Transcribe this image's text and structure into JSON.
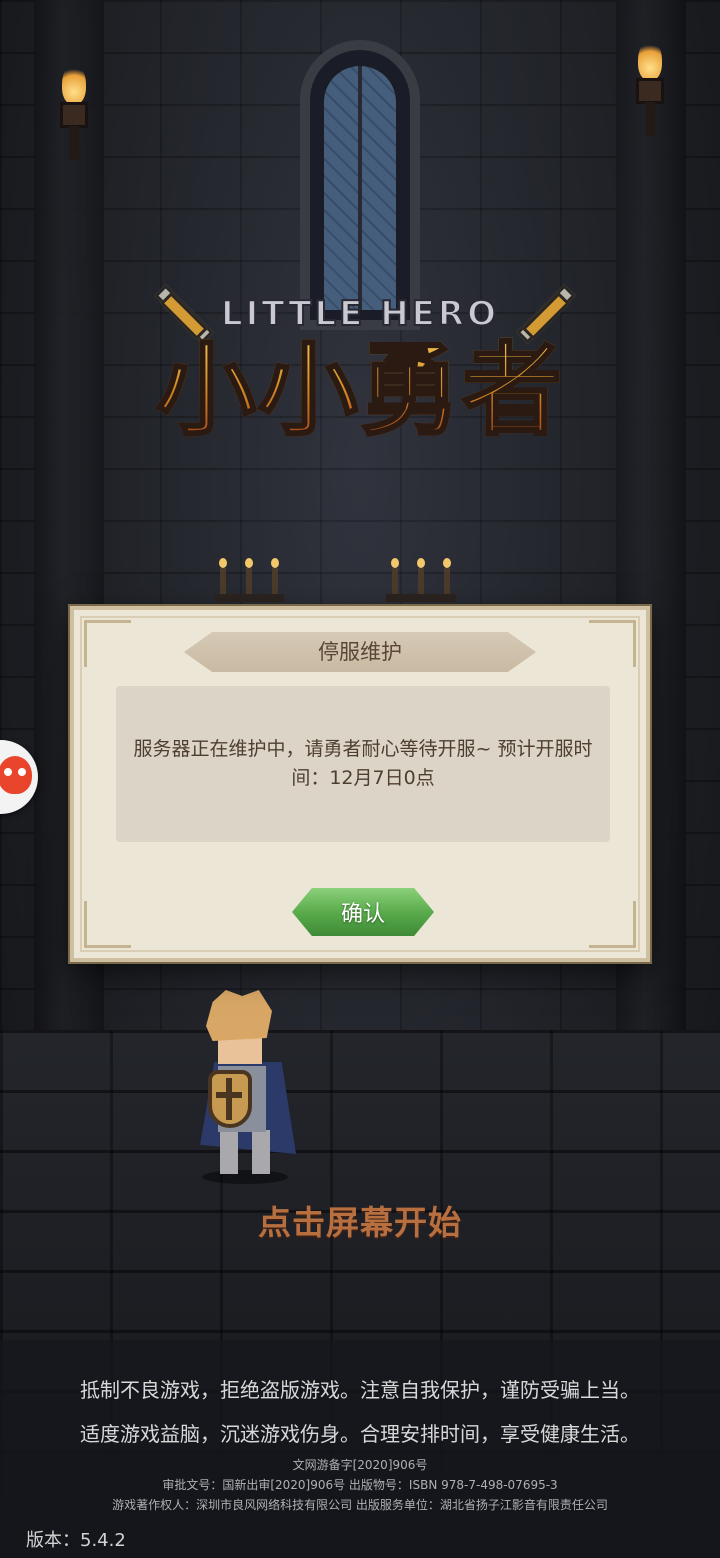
{
  "logo": {
    "subtitle": "LITTLE HERO",
    "title": "小小勇者"
  },
  "dialog": {
    "title": "停服维护",
    "message": "服务器正在维护中，请勇者耐心等待开服~ 预计开服时间：12月7日0点",
    "confirm_label": "确认"
  },
  "tap_to_start": "点击屏幕开始",
  "footer": {
    "notice_line1": "抵制不良游戏，拒绝盗版游戏。注意自我保护，谨防受骗上当。",
    "notice_line2": "适度游戏益脑，沉迷游戏伤身。合理安排时间，享受健康生活。",
    "record_line": "文网游备字[2020]906号",
    "approval_line": "审批文号：国新出审[2020]906号  出版物号：ISBN 978-7-498-07695-3",
    "copyright_line": "游戏著作权人：深圳市良风网络科技有限公司  出版服务单位：湖北省扬子江影音有限责任公司",
    "version": "版本：5.4.2"
  },
  "side_widget": {
    "icon": "mascot-face-icon"
  },
  "colors": {
    "dialog_bg": "#ece6d7",
    "confirm_button": "#56a849",
    "tap_start_text": "#b86f3f",
    "logo_gold": "#d58d25"
  }
}
